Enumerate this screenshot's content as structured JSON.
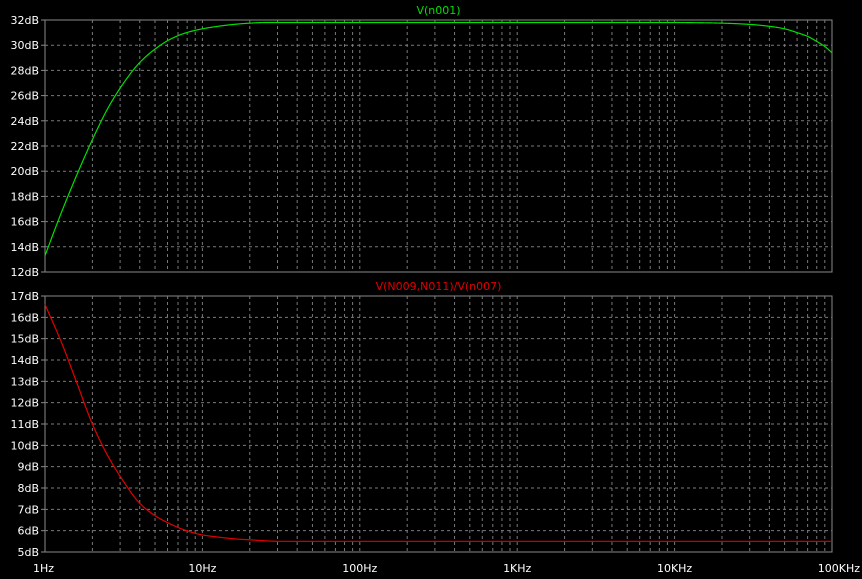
{
  "chart_data": [
    {
      "type": "line",
      "title": "V(n001)",
      "x_scale": "log",
      "xlim": [
        1,
        100000
      ],
      "ylim": [
        12,
        32
      ],
      "y_ticks": [
        "12dB",
        "14dB",
        "16dB",
        "18dB",
        "20dB",
        "22dB",
        "24dB",
        "26dB",
        "28dB",
        "30dB",
        "32dB"
      ],
      "grid": true,
      "series": [
        {
          "name": "V(n001)",
          "color": "#00e000",
          "x": [
            1,
            1.26,
            1.58,
            2,
            2.51,
            3.16,
            3.98,
            5.01,
            6.31,
            7.94,
            10,
            12.6,
            15.8,
            20,
            25,
            31.6,
            50,
            100,
            1000,
            10000,
            15000,
            20000,
            30000,
            40000,
            50000,
            60000,
            70000,
            80000,
            90000,
            100000
          ],
          "values": [
            13.3,
            16.6,
            19.6,
            22.5,
            25.0,
            27.0,
            28.6,
            29.7,
            30.5,
            31.0,
            31.3,
            31.5,
            31.65,
            31.75,
            31.8,
            31.8,
            31.8,
            31.8,
            31.8,
            31.8,
            31.78,
            31.75,
            31.65,
            31.5,
            31.3,
            31.0,
            30.7,
            30.3,
            29.9,
            29.4
          ]
        }
      ]
    },
    {
      "type": "line",
      "title": "V(N009,N011)/V(n007)",
      "x_scale": "log",
      "xlim": [
        1,
        100000
      ],
      "ylim": [
        5,
        17
      ],
      "y_ticks": [
        "5dB",
        "6dB",
        "7dB",
        "8dB",
        "9dB",
        "10dB",
        "11dB",
        "12dB",
        "13dB",
        "14dB",
        "15dB",
        "16dB",
        "17dB"
      ],
      "x_ticks": [
        "1Hz",
        "10Hz",
        "100Hz",
        "1KHz",
        "10KHz",
        "100KHz"
      ],
      "grid": true,
      "series": [
        {
          "name": "V(N009,N011)/V(n007)",
          "color": "#e00000",
          "x": [
            1,
            1.26,
            1.58,
            2,
            2.51,
            3.16,
            3.98,
            5.01,
            6.31,
            7.94,
            10,
            12.6,
            15.8,
            20,
            31.6,
            100,
            1000,
            10000,
            100000
          ],
          "values": [
            16.6,
            14.9,
            13.0,
            11.0,
            9.5,
            8.3,
            7.3,
            6.7,
            6.3,
            6.0,
            5.8,
            5.7,
            5.62,
            5.57,
            5.5,
            5.5,
            5.5,
            5.5,
            5.5
          ]
        }
      ]
    }
  ]
}
